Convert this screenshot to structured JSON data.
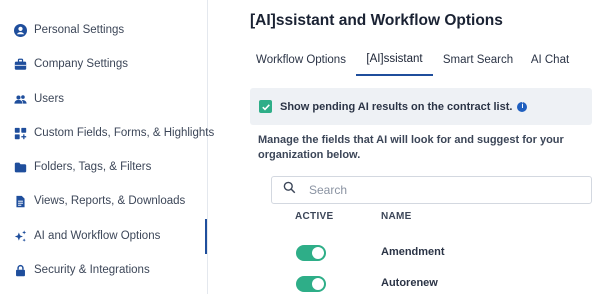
{
  "sidebar": {
    "items": [
      {
        "label": "Personal Settings",
        "icon": "user-circle-icon"
      },
      {
        "label": "Company Settings",
        "icon": "briefcase-icon"
      },
      {
        "label": "Users",
        "icon": "users-icon"
      },
      {
        "label": "Custom Fields, Forms, & Highlights",
        "icon": "grid-plus-icon"
      },
      {
        "label": "Folders, Tags, & Filters",
        "icon": "folder-icon"
      },
      {
        "label": "Views, Reports, & Downloads",
        "icon": "document-icon"
      },
      {
        "label": "AI and Workflow Options",
        "icon": "sparkle-icon",
        "active": true
      },
      {
        "label": "Security & Integrations",
        "icon": "lock-icon"
      }
    ]
  },
  "main": {
    "title": "[AI]ssistant and Workflow Options",
    "tabs": [
      {
        "label": "Workflow Options",
        "active": false
      },
      {
        "label": "[AI]ssistant",
        "active": true
      },
      {
        "label": "Smart Search",
        "active": false
      },
      {
        "label": "AI Chat",
        "active": false
      }
    ],
    "pending_checkbox": {
      "label": "Show pending AI results on the contract list.",
      "checked": true
    },
    "description": "Manage the fields that AI will look for and suggest for your organization below.",
    "search": {
      "placeholder": "Search",
      "value": ""
    },
    "table": {
      "columns": [
        "ACTIVE",
        "NAME"
      ],
      "rows": [
        {
          "active": true,
          "name": "Amendment"
        },
        {
          "active": true,
          "name": "Autorenew"
        }
      ]
    }
  },
  "colors": {
    "accent": "#1f4e9c",
    "toggle_on": "#2eae88",
    "notice_bg": "#eef1f5"
  }
}
